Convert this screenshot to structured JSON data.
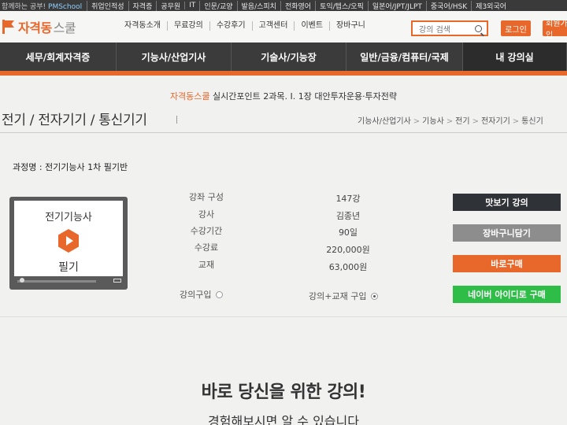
{
  "topbar": {
    "promo_prefix": "함께하는 공부!",
    "promo_brand": "PMSchool",
    "links": [
      "취업인적성",
      "자격증",
      "공무원",
      "IT",
      "인문/교양",
      "발음/스피치",
      "전화영어",
      "토익/텝스/오픽",
      "일본어/JPT/JLPT",
      "중국어/HSK",
      "제3외국어"
    ]
  },
  "header": {
    "logo_text": "자격동",
    "logo_sub": "스쿨",
    "gnb": [
      "자격동소개",
      "무료강의",
      "수강후기",
      "고객센터",
      "이벤트",
      "장바구니"
    ],
    "search_placeholder": "강의 검색",
    "login_label": "로그인",
    "join_label": "회원가입"
  },
  "mainnav": {
    "items": [
      {
        "label": "세무/회계자격증"
      },
      {
        "label": "기능사/산업기사"
      },
      {
        "label": "기술사/기능장"
      },
      {
        "label": "일반/금융/컴퓨터/국제"
      },
      {
        "label": "내 강의실"
      }
    ]
  },
  "ticker": {
    "brand": "자격동스쿨",
    "text": " 실시간포인트 2과목. I. 1장 대안투자운용·투자전략"
  },
  "page": {
    "title": "전기 / 전자기기 / 통신기기",
    "breadcrumb": [
      "기능사/산업기사",
      "기능사",
      "전기",
      "전자기기",
      "통신기"
    ]
  },
  "course": {
    "name": "과정명 : 전기기능사 1차 필기반",
    "thumb_title": "전기기능사",
    "thumb_subtitle": "필기",
    "info": [
      {
        "label": "강좌 구성",
        "value": "147강"
      },
      {
        "label": "강사",
        "value": "김종년"
      },
      {
        "label": "수강기간",
        "value": "90일"
      },
      {
        "label": "수강료",
        "value": "220,000원"
      },
      {
        "label": "교재",
        "value": "63,000원"
      }
    ],
    "options": [
      {
        "label": "강의구입",
        "checked": false
      },
      {
        "label": "강의+교재 구입",
        "checked": true
      }
    ]
  },
  "actions": {
    "preview": "맛보기 강의",
    "cart": "장바구니담기",
    "buy": "바로구매",
    "naver": "네이버 아이디로 구매"
  },
  "promo": {
    "slogan": "바로 당신을 위한 강의!",
    "sub": "경험해보시면 알 수 있습니다"
  },
  "colors": {
    "accent": "#e8672a",
    "nav_bg": "#3b3b3b",
    "preview_btn": "#2f3236",
    "cart_btn": "#8d8d8d",
    "naver_btn": "#2ebd46"
  }
}
